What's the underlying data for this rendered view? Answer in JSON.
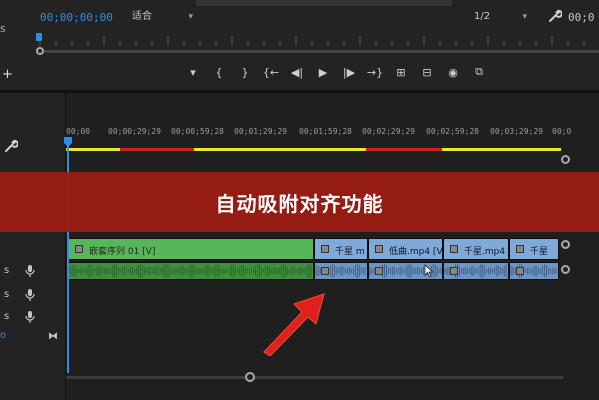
{
  "program_monitor": {
    "timecode": "00;00;00;00",
    "fit_label": "适合",
    "resolution_label": "1/2",
    "end_timecode": "00;0",
    "left_stub_top": "s",
    "left_stub_bottom": "+"
  },
  "transport": {
    "buttons": [
      "marker-icon",
      "in-point-icon",
      "out-point-icon",
      "go-to-in-icon",
      "step-back-icon",
      "play-icon",
      "step-forward-icon",
      "go-to-out-icon",
      "insert-icon",
      "overwrite-icon",
      "export-frame-icon",
      "compare-icon"
    ],
    "glyphs": [
      "▾",
      "{",
      "}",
      "{←",
      "◀|",
      "▶",
      "|▶",
      "→}",
      "⊞",
      "⊟",
      "◉",
      "⧉"
    ]
  },
  "timeline": {
    "ruler_ticks": [
      "00;00",
      "00;00;29;29",
      "00;00;59;28",
      "00;01;29;29",
      "00;01;59;28",
      "00;02;29;29",
      "00;02;59;28",
      "00;03;29;29",
      "00;0"
    ],
    "work_area": [
      {
        "color": "#e8e830",
        "weight": 54
      },
      {
        "color": "#cc2222",
        "weight": 74
      },
      {
        "color": "#e8e830",
        "weight": 172
      },
      {
        "color": "#cc2222",
        "weight": 76
      },
      {
        "color": "#e8e830",
        "weight": 119
      }
    ],
    "video_clips": [
      {
        "name": "嵌套序列 01 [V]",
        "color": "green"
      },
      {
        "name": "千星 m",
        "color": "blue"
      },
      {
        "name": "低曲.mp4 [V]",
        "color": "blue"
      },
      {
        "name": "千星.mp4 [",
        "color": "blue"
      },
      {
        "name": "千星",
        "color": "blue"
      }
    ],
    "audio_rows": [
      {
        "s": "s",
        "mic": "mic-icon"
      },
      {
        "s": "s",
        "mic": "mic-icon"
      },
      {
        "s": "s",
        "mic": "mic-icon"
      }
    ],
    "header_o": "o",
    "header_bow": "⧓"
  },
  "overlay": {
    "title": "自动吸附对齐功能",
    "banner_color": "#a01c12",
    "arrow_color": "#e0201a"
  },
  "colors": {
    "accent_blue": "#2d8ceb",
    "clip_green": "#57b65a",
    "clip_blue": "#7ea9d8"
  }
}
